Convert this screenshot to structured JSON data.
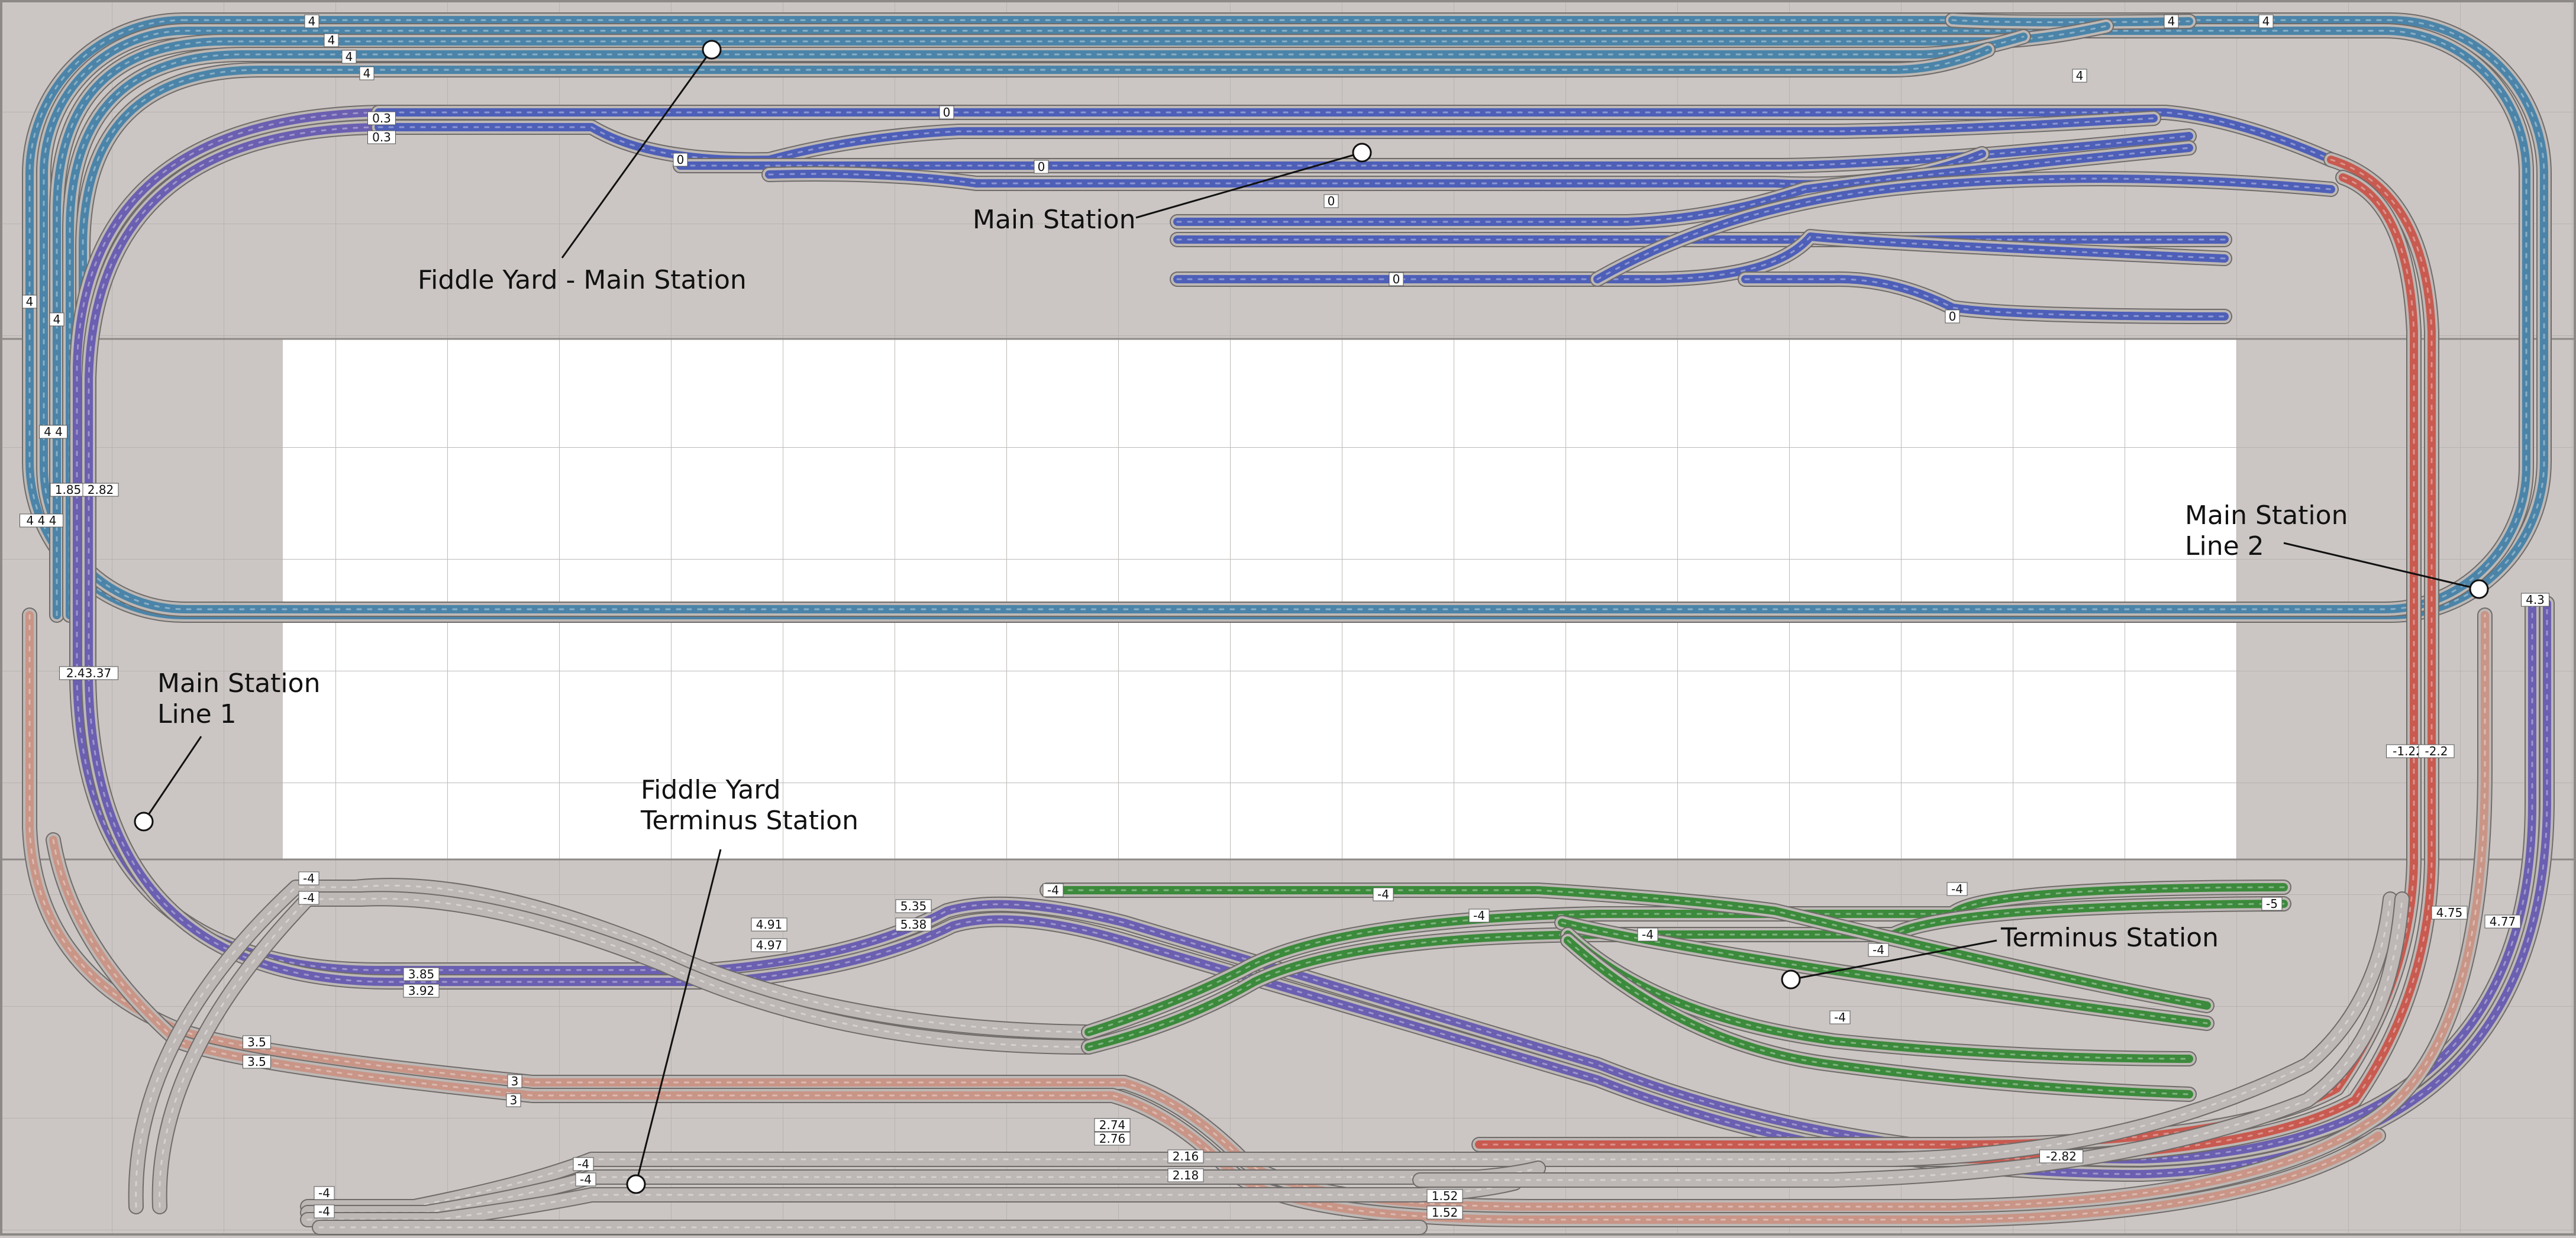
{
  "title": "",
  "colors": {
    "background": "#cbc6c3",
    "inner_board": "#ffffff",
    "fiddle_yard_main": "#4b84a8",
    "main_station": "#4e5fb8",
    "main_line_1": "#6a5fb0",
    "main_line_2": "#c85a50",
    "line_pink": "#c99587",
    "fiddle_yard_terminus": "#c42020",
    "terminus_station": "#3c8a3c"
  },
  "labels": {
    "fiddle_yard_main": "Fiddle Yard - Main Station",
    "main_station": "Main Station",
    "main_station_line_1": "Main Station\nLine 1",
    "main_station_line_2": "Main Station\nLine 2",
    "fiddle_yard_terminus": "Fiddle Yard\nTerminus Station",
    "terminus_station": "Terminus Station"
  },
  "height_markers": {
    "fiddle_top": [
      "4",
      "4",
      "4",
      "4"
    ],
    "fiddle_right": [
      "4",
      "4",
      "4"
    ],
    "fiddle_left": [
      "4",
      "4",
      "4 4",
      "4 4 4"
    ],
    "main_station": [
      "0.3",
      "0.3",
      "0",
      "0",
      "0",
      "0",
      "0",
      "0"
    ],
    "line1": [
      "1.85",
      "2.82",
      "2.43.37",
      "3.85",
      "3.92",
      "3.5",
      "3.5",
      "4.91",
      "4.97",
      "5.35",
      "5.38"
    ],
    "line2": [
      "-1.22",
      "-2.2",
      "-2.82",
      "4.75",
      "4.77",
      "4.3"
    ],
    "pink": [
      "2.74",
      "2.76",
      "2.16",
      "2.18",
      "1.52",
      "1.52",
      "3",
      "3"
    ],
    "terminus": [
      "-4",
      "-4",
      "-4",
      "-4",
      "-4",
      "-4",
      "-4",
      "-5"
    ],
    "fiddle_terminus": [
      "-4",
      "-4",
      "-4",
      "-4",
      "-4",
      "-4"
    ]
  }
}
